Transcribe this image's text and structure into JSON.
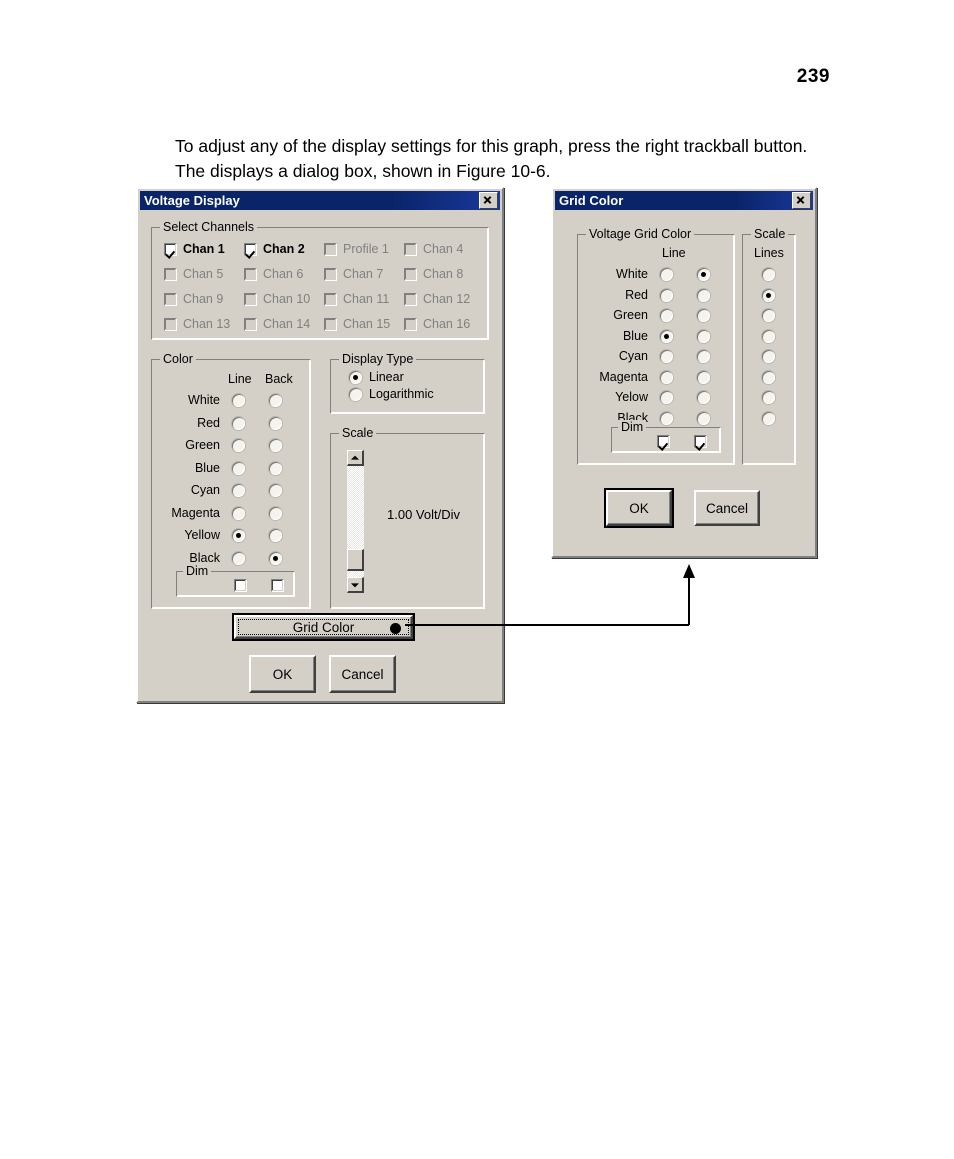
{
  "page": {
    "number": "239",
    "paragraph": "To adjust any of the display settings for this graph, press the right trackball button. The displays a dialog box, shown in Figure 10-6."
  },
  "voltage_display_dialog": {
    "title": "Voltage Display",
    "close_label": "×",
    "select_channels": {
      "group_title": "Select Channels",
      "items": [
        {
          "label": "Chan 1",
          "checked": true,
          "enabled": true
        },
        {
          "label": "Chan 2",
          "checked": true,
          "enabled": true
        },
        {
          "label": "Profile 1",
          "checked": false,
          "enabled": false
        },
        {
          "label": "Chan 4",
          "checked": false,
          "enabled": false
        },
        {
          "label": "Chan 5",
          "checked": false,
          "enabled": false
        },
        {
          "label": "Chan 6",
          "checked": false,
          "enabled": false
        },
        {
          "label": "Chan 7",
          "checked": false,
          "enabled": false
        },
        {
          "label": "Chan 8",
          "checked": false,
          "enabled": false
        },
        {
          "label": "Chan 9",
          "checked": false,
          "enabled": false
        },
        {
          "label": "Chan 10",
          "checked": false,
          "enabled": false
        },
        {
          "label": "Chan 11",
          "checked": false,
          "enabled": false
        },
        {
          "label": "Chan 12",
          "checked": false,
          "enabled": false
        },
        {
          "label": "Chan 13",
          "checked": false,
          "enabled": false
        },
        {
          "label": "Chan 14",
          "checked": false,
          "enabled": false
        },
        {
          "label": "Chan 15",
          "checked": false,
          "enabled": false
        },
        {
          "label": "Chan 16",
          "checked": false,
          "enabled": false
        }
      ]
    },
    "color": {
      "group_title": "Color",
      "column_headers": [
        "Line",
        "Back"
      ],
      "rows": [
        {
          "label": "White",
          "line": false,
          "back": false
        },
        {
          "label": "Red",
          "line": false,
          "back": false
        },
        {
          "label": "Green",
          "line": false,
          "back": false
        },
        {
          "label": "Blue",
          "line": false,
          "back": false
        },
        {
          "label": "Cyan",
          "line": false,
          "back": false
        },
        {
          "label": "Magenta",
          "line": false,
          "back": false
        },
        {
          "label": "Yellow",
          "line": true,
          "back": false
        },
        {
          "label": "Black",
          "line": false,
          "back": true
        }
      ],
      "dim": {
        "group_title": "Dim",
        "line_checked": false,
        "back_checked": false
      }
    },
    "display_type": {
      "group_title": "Display Type",
      "options": [
        {
          "label": "Linear",
          "selected": true
        },
        {
          "label": "Logarithmic",
          "selected": false
        }
      ]
    },
    "scale": {
      "group_title": "Scale",
      "value_label": "1.00 Volt/Div"
    },
    "buttons": {
      "grid_color": "Grid Color",
      "ok": "OK",
      "cancel": "Cancel"
    }
  },
  "grid_color_dialog": {
    "title": "Grid Color",
    "close_label": "×",
    "voltage_grid_color": {
      "group_title": "Voltage Grid Color",
      "column_header": "Line",
      "rows": [
        {
          "label": "White",
          "col1": false,
          "col2": true
        },
        {
          "label": "Red",
          "col1": false,
          "col2": false
        },
        {
          "label": "Green",
          "col1": false,
          "col2": false
        },
        {
          "label": "Blue",
          "col1": true,
          "col2": false
        },
        {
          "label": "Cyan",
          "col1": false,
          "col2": false
        },
        {
          "label": "Magenta",
          "col1": false,
          "col2": false
        },
        {
          "label": "Yelow",
          "col1": false,
          "col2": false
        },
        {
          "label": "Black",
          "col1": false,
          "col2": false
        }
      ],
      "dim": {
        "group_title": "Dim",
        "col1_checked": true,
        "col2_checked": true
      }
    },
    "scale": {
      "group_title": "Scale",
      "column_header": "Lines",
      "values": [
        false,
        true,
        false,
        false,
        false,
        false,
        false,
        false
      ]
    },
    "buttons": {
      "ok": "OK",
      "cancel": "Cancel"
    }
  },
  "colors": {
    "dialog_face": "#d4d0c8",
    "titlebar": "#0a246a",
    "titlebar_text": "#ffffff",
    "disabled_text": "#808080",
    "text": "#000000"
  }
}
